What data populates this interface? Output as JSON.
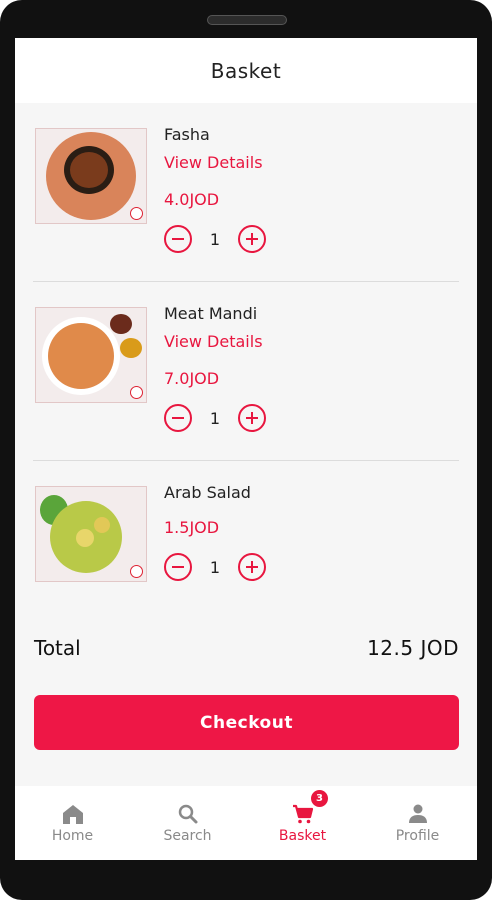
{
  "header": {
    "title": "Basket"
  },
  "items": [
    {
      "name": "Fasha",
      "view_details": "View Details",
      "price": "4.0JOD",
      "quantity": "1"
    },
    {
      "name": "Meat Mandi",
      "view_details": "View Details",
      "price": "7.0JOD",
      "quantity": "1"
    },
    {
      "name": "Arab Salad",
      "price": "1.5JOD",
      "quantity": "1"
    }
  ],
  "summary": {
    "total_label": "Total",
    "total_value": "12.5 JOD"
  },
  "checkout": {
    "label": "Checkout"
  },
  "tabbar": {
    "tabs": [
      {
        "label": "Home",
        "icon": "home-icon"
      },
      {
        "label": "Search",
        "icon": "search-icon"
      },
      {
        "label": "Basket",
        "icon": "cart-icon",
        "badge": "3",
        "active": true
      },
      {
        "label": "Profile",
        "icon": "profile-icon"
      }
    ]
  },
  "colors": {
    "accent": "#e8163f",
    "button": "#ee1746",
    "background": "#f6f6f6",
    "inactive": "#8a8a8a"
  }
}
